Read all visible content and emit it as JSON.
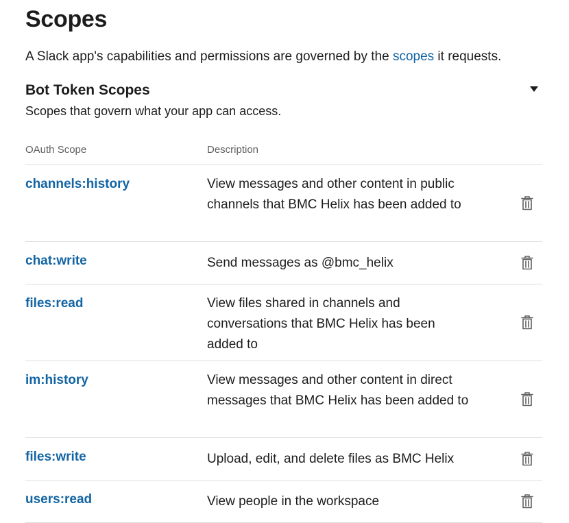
{
  "page": {
    "title": "Scopes",
    "intro_before": "A Slack app's capabilities and permissions are governed by the ",
    "intro_link": "scopes",
    "intro_after": " it requests."
  },
  "section": {
    "title": "Bot Token Scopes",
    "subtitle": "Scopes that govern what your app can access.",
    "toggle_icon": "caret-down-icon"
  },
  "table": {
    "headers": {
      "scope": "OAuth Scope",
      "description": "Description"
    },
    "rows": [
      {
        "scope": "channels:history",
        "description": "View messages and other content in public channels that BMC Helix has been added to",
        "action_icon": "trash-icon"
      },
      {
        "scope": "chat:write",
        "description": "Send messages as @bmc_helix",
        "action_icon": "trash-icon"
      },
      {
        "scope": "files:read",
        "description": "View files shared in channels and conversations that BMC Helix has been added to",
        "action_icon": "trash-icon"
      },
      {
        "scope": "im:history",
        "description": "View messages and other content in direct messages that BMC Helix has been added to",
        "action_icon": "trash-icon"
      },
      {
        "scope": "files:write",
        "description": "Upload, edit, and delete files as BMC Helix",
        "action_icon": "trash-icon"
      },
      {
        "scope": "users:read",
        "description": "View people in the workspace",
        "action_icon": "trash-icon"
      }
    ]
  },
  "colors": {
    "link": "#1264a3",
    "text": "#1d1c1d",
    "muted": "#616061",
    "divider": "#dddddd",
    "icon": "#616061"
  }
}
